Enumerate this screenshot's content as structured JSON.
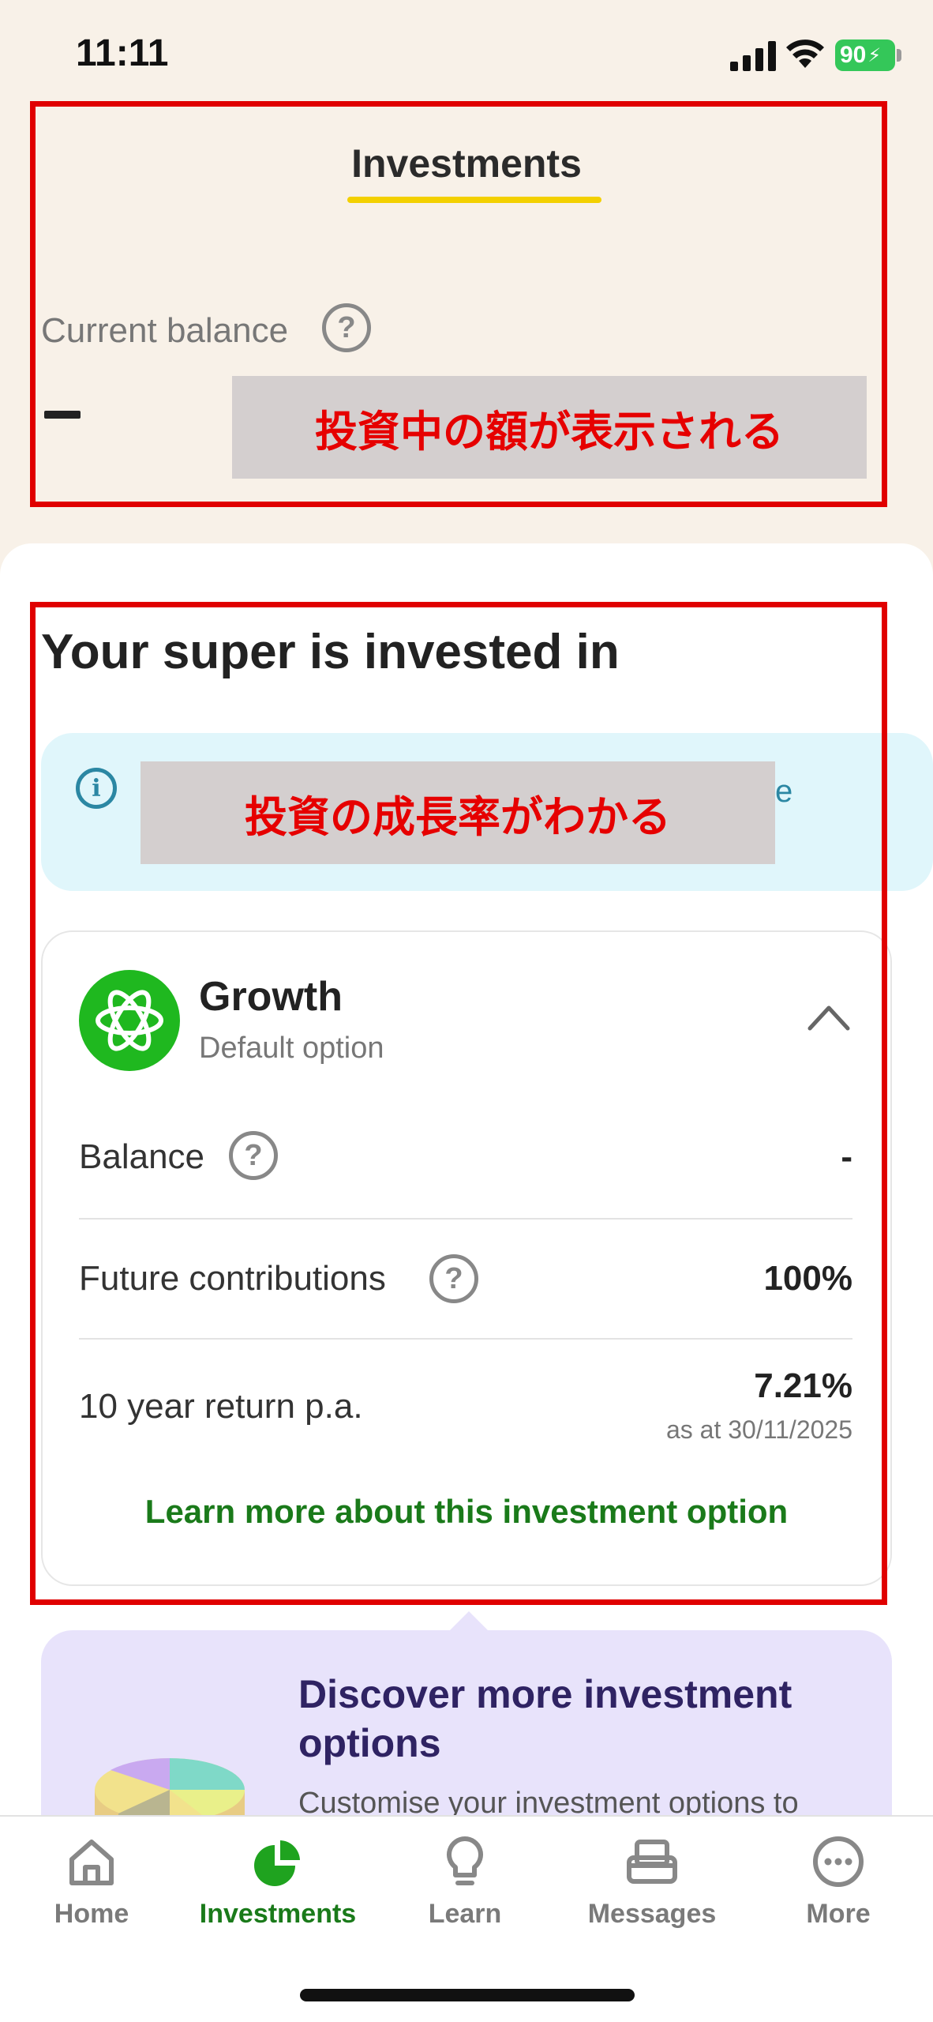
{
  "status_bar": {
    "time": "11:11",
    "battery": "90"
  },
  "header": {
    "title": "Investments",
    "balance_label": "Current balance",
    "balance_value": "–",
    "annotation": "投資中の額が表示される"
  },
  "section": {
    "title": "Your super is invested in",
    "info_trail": "e",
    "annotation": "投資の成長率がわかる"
  },
  "option": {
    "name": "Growth",
    "subtitle": "Default option",
    "rows": [
      {
        "label": "Balance",
        "value": "-"
      },
      {
        "label": "Future contributions",
        "value": "100%"
      },
      {
        "label": "10 year return p.a.",
        "value": "7.21%",
        "sub": "as at 30/11/2025"
      }
    ],
    "link": "Learn more about this investment option"
  },
  "discover": {
    "title": "Discover more investment options",
    "description": "Customise your investment options to"
  },
  "tabs": [
    {
      "label": "Home",
      "icon": "home-icon"
    },
    {
      "label": "Investments",
      "icon": "pie-chart-icon",
      "active": true
    },
    {
      "label": "Learn",
      "icon": "lightbulb-icon"
    },
    {
      "label": "Messages",
      "icon": "inbox-icon"
    },
    {
      "label": "More",
      "icon": "more-icon"
    }
  ],
  "colors": {
    "accent_green": "#1a7a1a",
    "annotation_red": "#e00000",
    "background": "#f8f1e8"
  }
}
